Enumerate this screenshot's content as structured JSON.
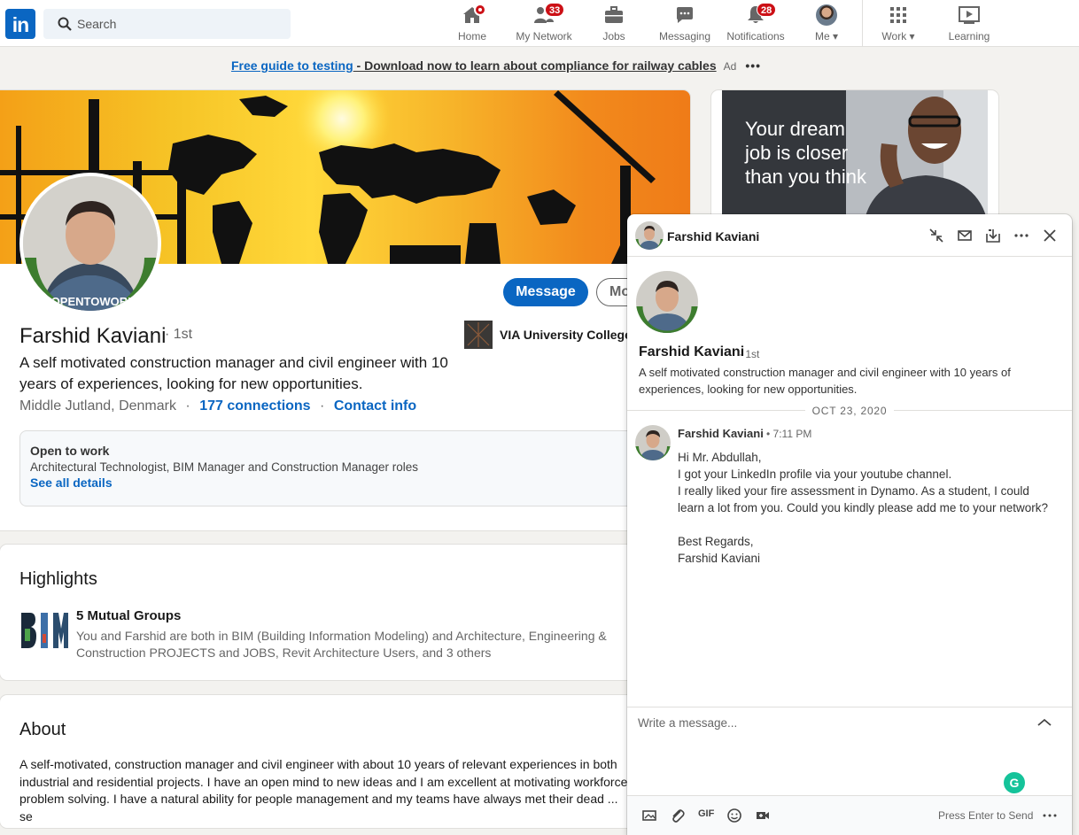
{
  "nav": {
    "logo": "in",
    "search_placeholder": "Search",
    "items": [
      {
        "label": "Home"
      },
      {
        "label": "My Network",
        "badge": "33"
      },
      {
        "label": "Jobs"
      },
      {
        "label": "Messaging"
      },
      {
        "label": "Notifications",
        "badge": "28"
      },
      {
        "label": "Me"
      },
      {
        "label": "Work"
      },
      {
        "label": "Learning"
      }
    ]
  },
  "adline": {
    "link": "Free guide to testing",
    "text": " - Download now to learn about compliance for railway cables",
    "ad_label": "Ad",
    "more": "•••"
  },
  "profile": {
    "message_btn": "Message",
    "more_btn": "Mo",
    "name": "Farshid Kaviani",
    "degree": "· 1st",
    "headline": "A self motivated construction manager and civil engineer with 10 years of experiences, looking for new opportunities.",
    "location": "Middle Jutland, Denmark",
    "sep": "·",
    "connections": "177 connections",
    "contact": "Contact info",
    "school": "VIA University College",
    "badge_text": "#OPENTOWORK",
    "open_to_work": {
      "title": "Open to work",
      "roles": "Architectural Technologist, BIM Manager and Construction Manager roles",
      "link": "See all details"
    }
  },
  "highlights": {
    "title": "Highlights",
    "item_title": "5 Mutual Groups",
    "item_desc": "You and Farshid are both in BIM (Building Information Modeling) and Architecture, Engineering & Construction PROJECTS and JOBS, Revit Architecture Users, and 3 others"
  },
  "about": {
    "title": "About",
    "text": "A self-motivated, construction manager and civil engineer with about 10 years of relevant experiences in both industrial and residential projects. I have an open mind to new ideas and I am excellent at motivating workforce problem solving. I have a natural ability for people management and my teams have always met their dead ... se"
  },
  "side_ad": {
    "text": "Your dream job is closer than you think"
  },
  "chat": {
    "header_name": "Farshid Kaviani",
    "profile_name": "Farshid Kaviani",
    "profile_degree": "· 1st",
    "profile_headline": "A self motivated construction manager and civil engineer with 10 years of experiences, looking for new opportunities.",
    "date": "OCT 23, 2020",
    "msg_sender": "Farshid Kaviani",
    "msg_time": "• 7:11 PM",
    "msg_lines": [
      "Hi Mr. Abdullah,",
      "I got your LinkedIn profile via your youtube channel.",
      "I really liked your fire assessment in Dynamo. As a student, I could learn a lot from you. Could you kindly please add me to your network?",
      "",
      "Best Regards,",
      "Farshid Kaviani"
    ],
    "composer_placeholder": "Write a message...",
    "gif_label": "GIF",
    "send_hint": "Press Enter to Send",
    "grammarly": "G"
  },
  "colors": {
    "brand": "#0a66c2",
    "badge": "#cc1016",
    "open_to_work_green": "#3d7d2e"
  }
}
